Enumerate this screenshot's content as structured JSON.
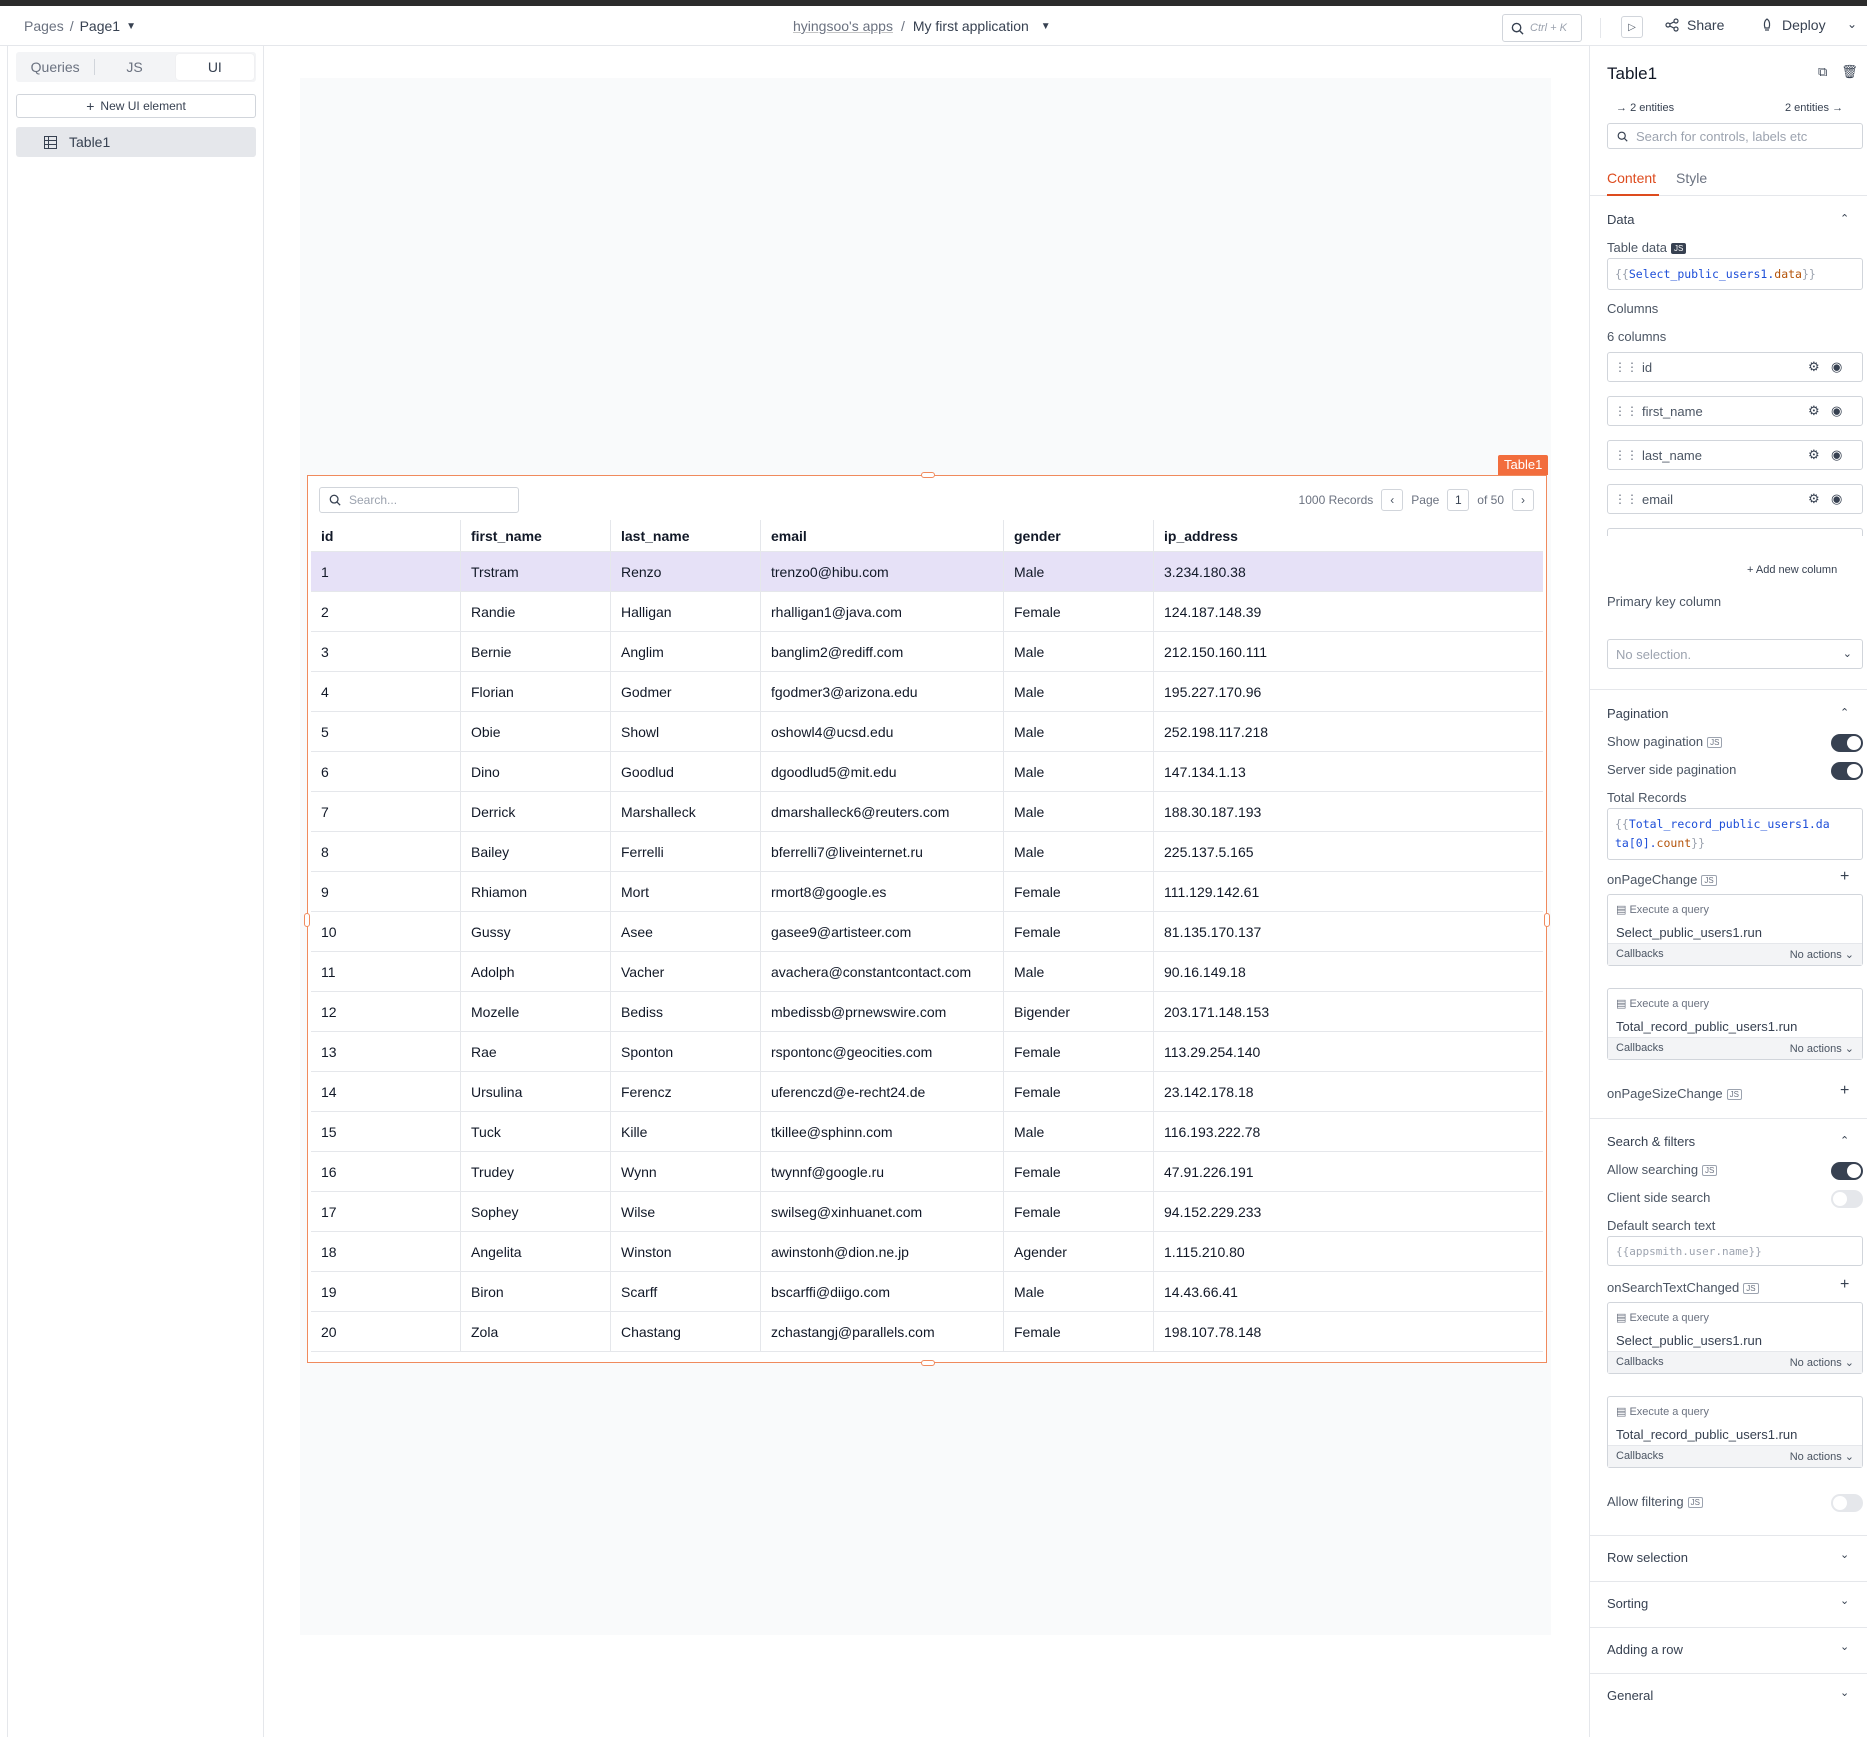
{
  "header": {
    "pages_label": "Pages",
    "page_sep": "/",
    "current_page": "Page1",
    "app_owner": "hyingsoo's apps",
    "app_sep": "/",
    "app_name": "My first application",
    "search_shortcut": "Ctrl + K",
    "share_label": "Share",
    "deploy_label": "Deploy"
  },
  "sidebar": {
    "tabs": [
      {
        "label": "Queries"
      },
      {
        "label": "JS"
      },
      {
        "label": "UI"
      }
    ],
    "new_ui_label": "New UI element",
    "entities": [
      {
        "label": "Table1"
      }
    ]
  },
  "table": {
    "widget_label": "Table1",
    "search_placeholder": "Search...",
    "records_text": "1000 Records",
    "page_label": "Page",
    "page_number": "1",
    "of_pages": "of 50",
    "columns": [
      "id",
      "first_name",
      "last_name",
      "email",
      "gender",
      "ip_address"
    ],
    "rows": [
      [
        "1",
        "Trstram",
        "Renzo",
        "trenzo0@hibu.com",
        "Male",
        "3.234.180.38"
      ],
      [
        "2",
        "Randie",
        "Halligan",
        "rhalligan1@java.com",
        "Female",
        "124.187.148.39"
      ],
      [
        "3",
        "Bernie",
        "Anglim",
        "banglim2@rediff.com",
        "Male",
        "212.150.160.111"
      ],
      [
        "4",
        "Florian",
        "Godmer",
        "fgodmer3@arizona.edu",
        "Male",
        "195.227.170.96"
      ],
      [
        "5",
        "Obie",
        "Showl",
        "oshowl4@ucsd.edu",
        "Male",
        "252.198.117.218"
      ],
      [
        "6",
        "Dino",
        "Goodlud",
        "dgoodlud5@mit.edu",
        "Male",
        "147.134.1.13"
      ],
      [
        "7",
        "Derrick",
        "Marshalleck",
        "dmarshalleck6@reuters.com",
        "Male",
        "188.30.187.193"
      ],
      [
        "8",
        "Bailey",
        "Ferrelli",
        "bferrelli7@liveinternet.ru",
        "Male",
        "225.137.5.165"
      ],
      [
        "9",
        "Rhiamon",
        "Mort",
        "rmort8@google.es",
        "Female",
        "111.129.142.61"
      ],
      [
        "10",
        "Gussy",
        "Asee",
        "gasee9@artisteer.com",
        "Female",
        "81.135.170.137"
      ],
      [
        "11",
        "Adolph",
        "Vacher",
        "avachera@constantcontact.com",
        "Male",
        "90.16.149.18"
      ],
      [
        "12",
        "Mozelle",
        "Bediss",
        "mbedissb@prnewswire.com",
        "Bigender",
        "203.171.148.153"
      ],
      [
        "13",
        "Rae",
        "Sponton",
        "rspontonc@geocities.com",
        "Female",
        "113.29.254.140"
      ],
      [
        "14",
        "Ursulina",
        "Ferencz",
        "uferenczd@e-recht24.de",
        "Female",
        "23.142.178.18"
      ],
      [
        "15",
        "Tuck",
        "Kille",
        "tkillee@sphinn.com",
        "Male",
        "116.193.222.78"
      ],
      [
        "16",
        "Trudey",
        "Wynn",
        "twynnf@google.ru",
        "Female",
        "47.91.226.191"
      ],
      [
        "17",
        "Sophey",
        "Wilse",
        "swilseg@xinhuanet.com",
        "Female",
        "94.152.229.233"
      ],
      [
        "18",
        "Angelita",
        "Winston",
        "awinstonh@dion.ne.jp",
        "Agender",
        "1.115.210.80"
      ],
      [
        "19",
        "Biron",
        "Scarff",
        "bscarffi@diigo.com",
        "Male",
        "14.43.66.41"
      ],
      [
        "20",
        "Zola",
        "Chastang",
        "zchastangj@parallels.com",
        "Female",
        "198.107.78.148"
      ]
    ]
  },
  "props": {
    "title": "Table1",
    "entities_left": "2 entities",
    "entities_right": "2 entities",
    "search_placeholder": "Search for controls, labels etc",
    "tab_content": "Content",
    "tab_style": "Style",
    "data_section": "Data",
    "table_data_label": "Table data",
    "js_badge": "JS",
    "table_data_open": "{{",
    "table_data_obj": "Select_public_users1.",
    "table_data_prop": "data",
    "table_data_close": "}}",
    "columns_label": "Columns",
    "columns_count": "6 columns",
    "column_items": [
      "id",
      "first_name",
      "last_name",
      "email"
    ],
    "add_column": "Add new column",
    "primary_key_label": "Primary key column",
    "primary_key_placeholder": "No selection.",
    "pagination_section": "Pagination",
    "show_pagination": "Show pagination",
    "server_side_pagination": "Server side pagination",
    "total_records_label": "Total Records",
    "total_records_l1_open": "{{",
    "total_records_l1": "Total_record_public_users1.da",
    "total_records_l2": "ta[0].",
    "total_records_l2_prop": "count",
    "total_records_close": "}}",
    "on_page_change": "onPageChange",
    "action_head": "Execute a query",
    "callbacks": "Callbacks",
    "no_actions": "No actions",
    "query_select": "Select_public_users1.run",
    "query_total": "Total_record_public_users1.run",
    "on_page_size_change": "onPageSizeChange",
    "search_filters_section": "Search & filters",
    "allow_searching": "Allow searching",
    "client_side_search": "Client side search",
    "default_search_label": "Default search text",
    "default_search_placeholder": "{{appsmith.user.name}}",
    "on_search_text_changed": "onSearchTextChanged",
    "allow_filtering": "Allow filtering",
    "row_selection": "Row selection",
    "sorting": "Sorting",
    "adding_a_row": "Adding a row",
    "general": "General"
  }
}
